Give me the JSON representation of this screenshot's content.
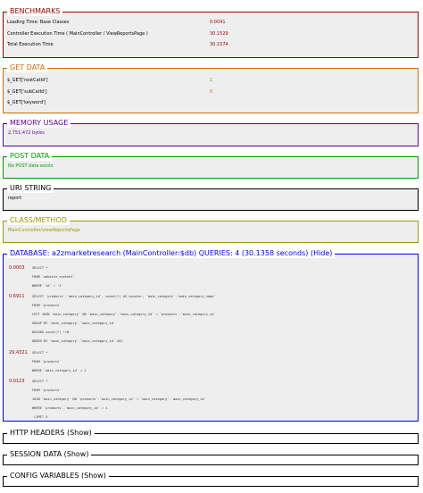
{
  "benchmarks": {
    "title": "BENCHMARKS",
    "rows": [
      {
        "label": "Loading Time: Base Classes",
        "value": "0.0041"
      },
      {
        "label": "Controller Execution Time ( MainController / ViewReportsPage )",
        "value": "30.1529"
      },
      {
        "label": "Total Execution Time",
        "value": "30.1574"
      }
    ]
  },
  "get_data": {
    "title": "GET DATA",
    "rows": [
      {
        "label": "$_GET['rootCatId']",
        "value": "1"
      },
      {
        "label": "$_GET['subCatId']",
        "value": "0"
      },
      {
        "label": "$_GET['keyword']",
        "value": ""
      }
    ]
  },
  "memory": {
    "title": "MEMORY USAGE",
    "value": "2,751,472 bytes"
  },
  "post": {
    "title": "POST DATA",
    "value": "No POST data exists"
  },
  "uri": {
    "title": "URI STRING",
    "value": "report"
  },
  "class_method": {
    "title": "CLASS/METHOD",
    "value": "MainController/viewReportsPage"
  },
  "database": {
    "title": "DATABASE:  a2zmarketresearch (MainController:$db)   QUERIES: 4 (30.1358 seconds)  (Hide)",
    "queries": [
      {
        "time": "0.0003",
        "lines": [
          "SELECT *",
          "FROM `website_content`",
          "WHERE `id` = '1'"
        ]
      },
      {
        "time": "0.6911",
        "lines": [
          "SELECT `products`.`main_category_id`, count(*) AS counter, `main_category`.`main_category_name`",
          "FROM `products`",
          "LEFT JOIN `main_category` ON `main_category`.`main_category_id` = `products`.`main_category_id`",
          "GROUP BY `main_category`.`main_category_id`",
          "HAVING count(*) !=0",
          "ORDER BY `main_category`.`main_category_id` ASC"
        ]
      },
      {
        "time": "29.4321",
        "lines": [
          "SELECT *",
          "FROM `products`",
          "WHERE `main_category_id` = 1"
        ]
      },
      {
        "time": "0.0123",
        "lines": [
          "SELECT *",
          "FROM `products`",
          "JOIN `main_category` ON `products`.`main_category_id` = `main_category`.`main_category_id`",
          "WHERE `products`.`main_category_id` = 1",
          " LIMIT 5"
        ]
      }
    ]
  },
  "http_headers": {
    "title": "HTTP HEADERS  (Show)"
  },
  "session": {
    "title": "SESSION DATA  (Show)"
  },
  "config": {
    "title": "CONFIG VARIABLES  (Show)"
  },
  "colors": {
    "benchmarks": "#990000",
    "get": "#cd6e00",
    "memory": "#5a0099",
    "post": "#009900",
    "uri": "#000000",
    "class": "#999900",
    "db": "#0000ff",
    "headers": "#000000"
  }
}
